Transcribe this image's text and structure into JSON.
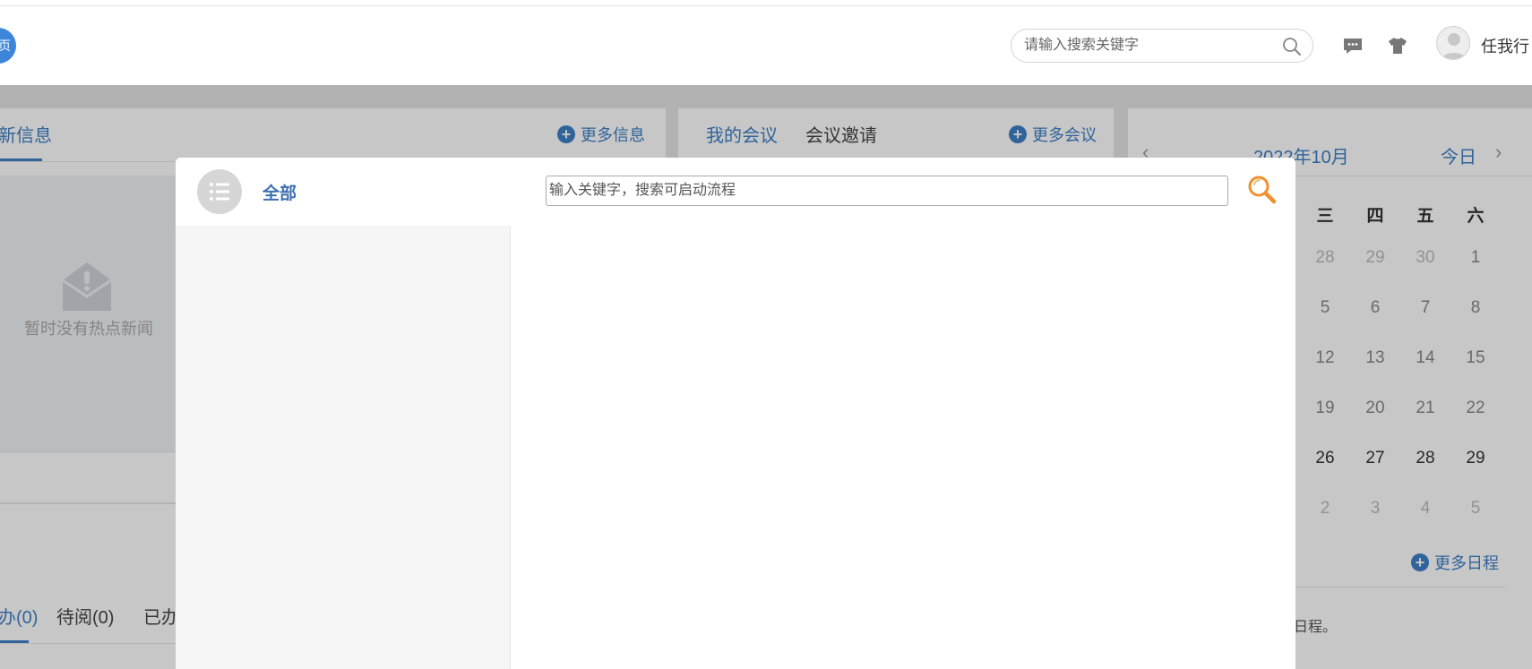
{
  "header": {
    "home_badge": "页",
    "search_placeholder": "请输入搜索关键字",
    "username": "任我行",
    "icons": [
      "search-icon",
      "message-icon",
      "shirt-icon",
      "avatar"
    ]
  },
  "news_panel": {
    "tab_active": "新信息",
    "more": "更多信息",
    "empty_text": "暂时没有热点新闻"
  },
  "meeting_panel": {
    "tab_active": "我的会议",
    "tab_invite": "会议邀请",
    "more": "更多会议"
  },
  "todo_panel": {
    "tab_active": "办(0)",
    "tab_read": "待阅(0)",
    "tab_done": "已办"
  },
  "calendar": {
    "month": "2022年10月",
    "today": "今日",
    "prev": "‹",
    "next": "›",
    "weekdays": [
      "三",
      "四",
      "五",
      "六"
    ],
    "rows": [
      [
        "28",
        "29",
        "30",
        "1"
      ],
      [
        "5",
        "6",
        "7",
        "8"
      ],
      [
        "12",
        "13",
        "14",
        "15"
      ],
      [
        "19",
        "20",
        "21",
        "22"
      ],
      [
        "26",
        "27",
        "28",
        "29"
      ],
      [
        "2",
        "3",
        "4",
        "5"
      ]
    ],
    "more": "更多日程",
    "note": "日程。"
  },
  "modal": {
    "category_all": "全部",
    "search_placeholder": "输入关键字，搜索可启动流程"
  },
  "colors": {
    "accent": "#3d7fc6",
    "search_orange": "#f0902e"
  }
}
